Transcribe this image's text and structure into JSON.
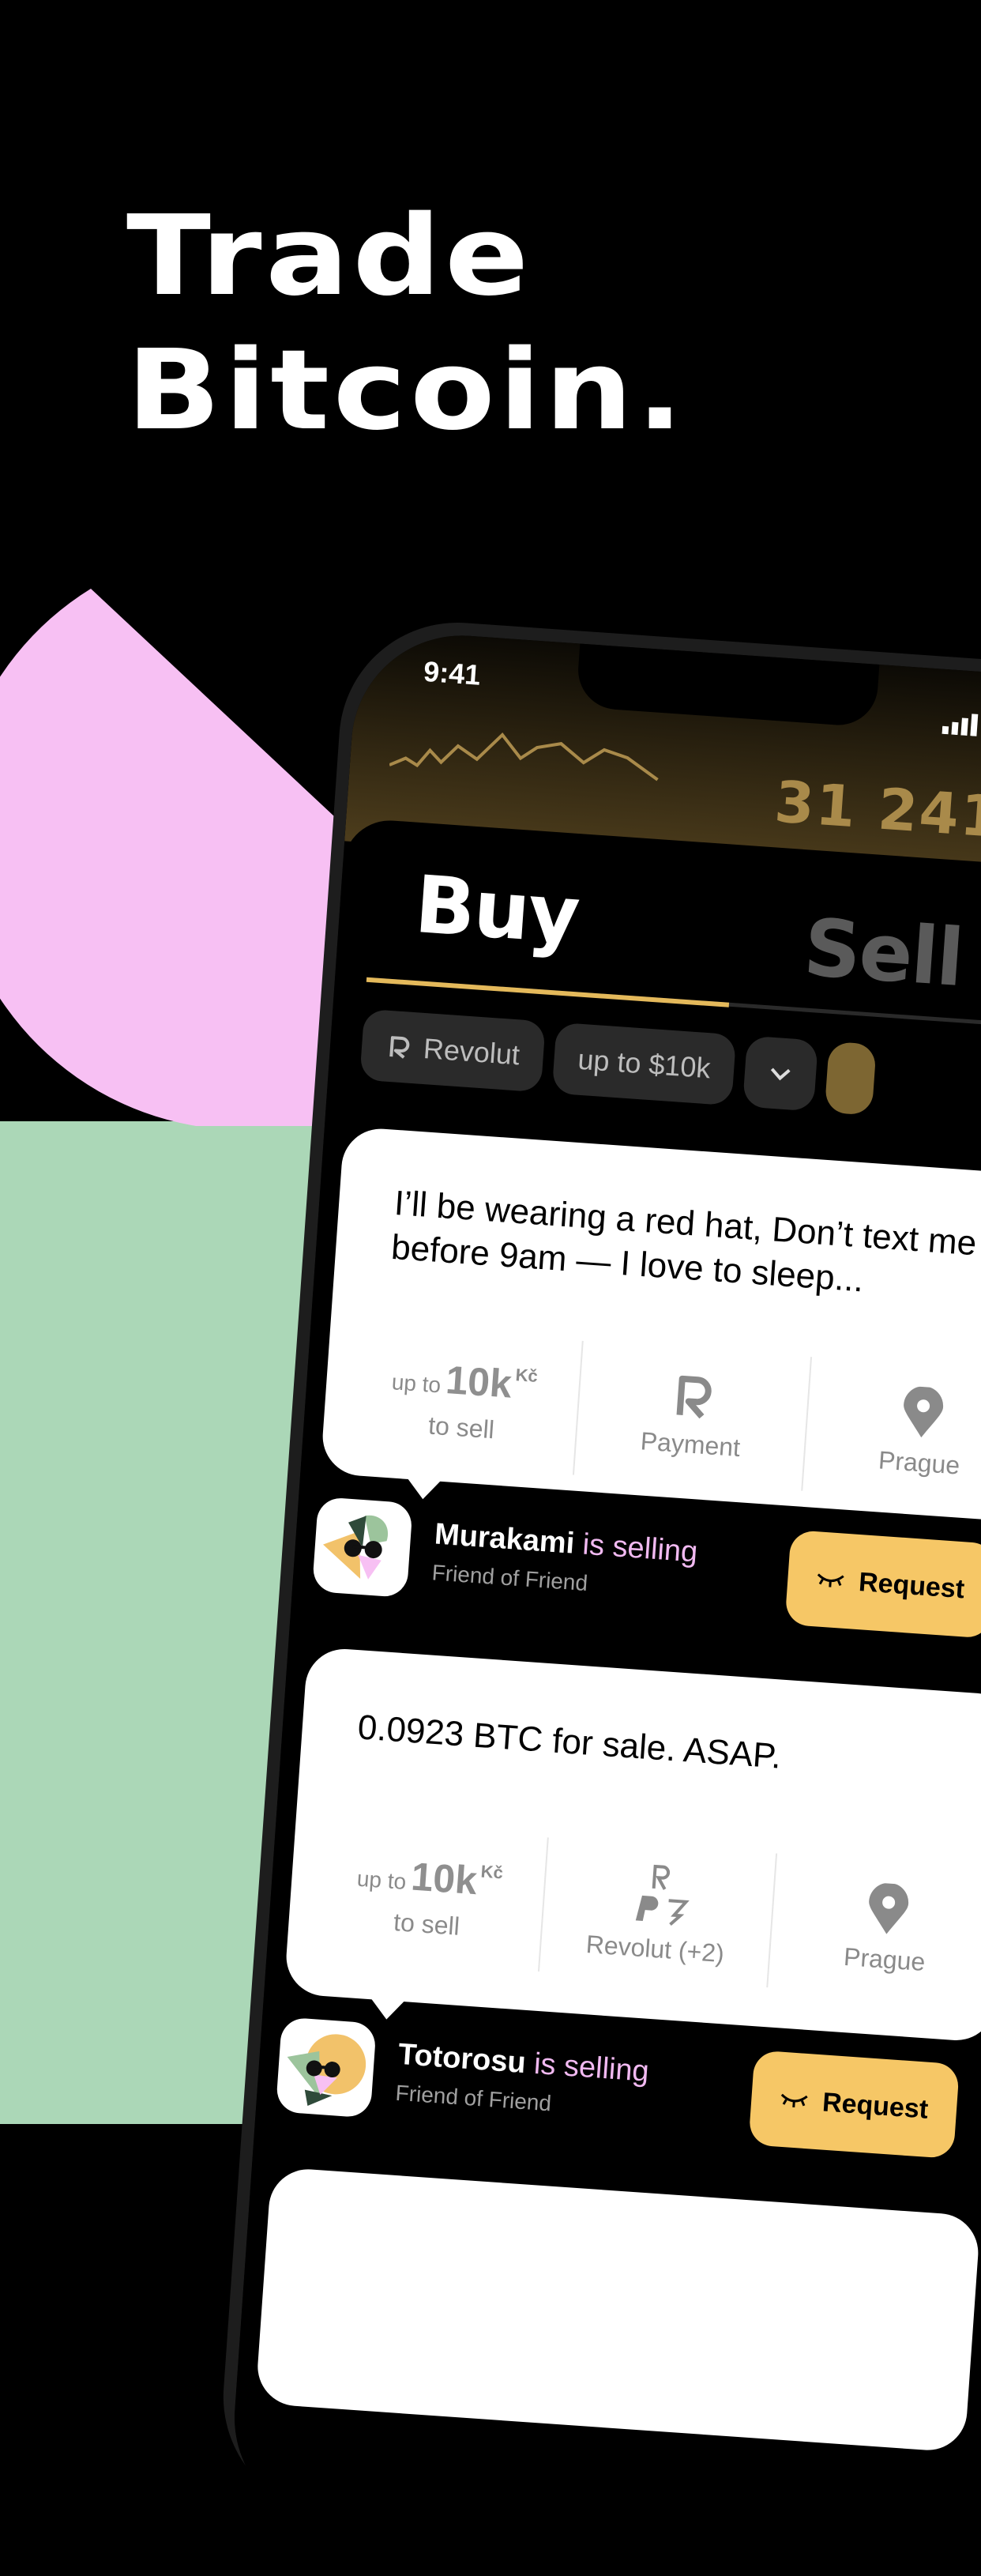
{
  "hero": {
    "line1": "Trade",
    "line2": "Bitcoin."
  },
  "colors": {
    "background": "#000000",
    "green": "#abd7b7",
    "pink": "#f7c0f3",
    "accent": "#f6c766",
    "tab_indicator": "#e4b95b"
  },
  "status_bar": {
    "time": "9:41"
  },
  "ticker": {
    "price": "31 241"
  },
  "tabs": [
    {
      "label": "Buy"
    },
    {
      "label": "Sell"
    }
  ],
  "filters": {
    "payment": {
      "label": "Revolut",
      "icon": "revolut-icon"
    },
    "limit": {
      "label": "up to $10k"
    },
    "dropdown_icon": "chevron-down-icon"
  },
  "offers": [
    {
      "message": "I’ll be wearing a red hat, Don’t text me before 9am — I love to sleep...",
      "amount_prefix": "up to",
      "amount": "10k",
      "currency": "Kč",
      "amount_caption": "to sell",
      "payment_label": "Payment",
      "location": "Prague",
      "seller": "Murakami",
      "action": "is selling",
      "relation": "Friend of Friend",
      "button": "Request"
    },
    {
      "message": "0.0923 BTC for sale. ASAP.",
      "amount_prefix": "up to",
      "amount": "10k",
      "currency": "Kč",
      "amount_caption": "to sell",
      "payment_label": "Revolut (+2)",
      "location": "Prague",
      "seller": "Totorosu",
      "action": "is selling",
      "relation": "Friend of Friend",
      "button": "Request"
    }
  ]
}
